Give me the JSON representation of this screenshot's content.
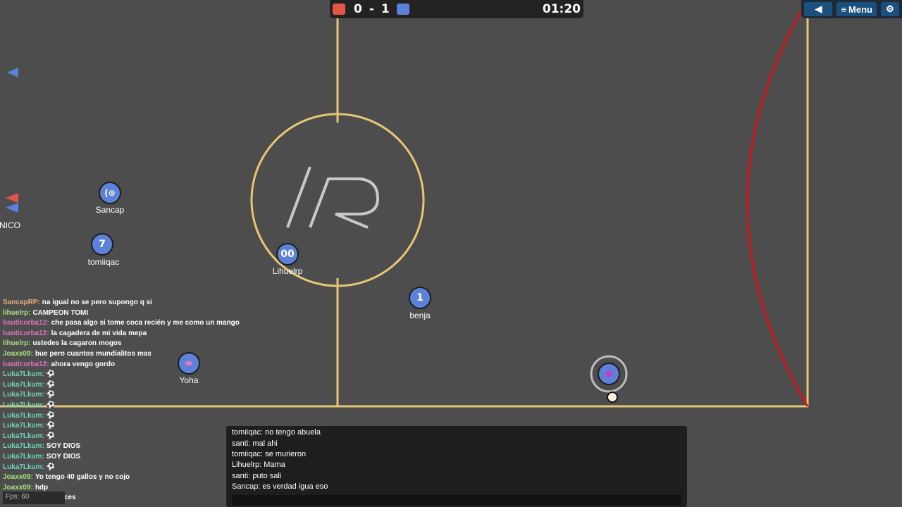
{
  "score": {
    "red": "0",
    "separator": "-",
    "blue": "1",
    "time": "01:20",
    "red_color": "#e0574a",
    "blue_color": "#5b82d8"
  },
  "menu": {
    "sound_icon": "speaker-icon",
    "menu_label": "Menu",
    "settings_icon": "gear-icon"
  },
  "players": [
    {
      "number": "(⊙",
      "name": "Sancap"
    },
    {
      "number": "7",
      "name": "tomiiqac"
    },
    {
      "number": "00",
      "name": "Lihuelrp"
    },
    {
      "number": "1",
      "name": "benja"
    },
    {
      "number": "",
      "name": "Yoha"
    },
    {
      "number": "",
      "name": "NICO"
    }
  ],
  "side_chat": [
    {
      "name": "SancapRP:",
      "text": "na igual no se pero supongo q si",
      "color": "#e0b080"
    },
    {
      "name": "lihuelrp:",
      "text": "CAMPEON TOMI",
      "color": "#a6e07a"
    },
    {
      "name": "bauticorba12:",
      "text": "che pasa algo si tome coca recién y me como un mango",
      "color": "#e070c0"
    },
    {
      "name": "bauticorba12:",
      "text": "la cagadera de mi vida mepa",
      "color": "#e070c0"
    },
    {
      "name": "lihuelrp:",
      "text": "ustedes la cagaron mogos",
      "color": "#a6e07a"
    },
    {
      "name": "Joaxx09:",
      "text": "bue pero cuantos mundialitos mas",
      "color": "#a6e07a"
    },
    {
      "name": "bauticorba12:",
      "text": "ahora vengo gordo",
      "color": "#e070c0"
    },
    {
      "name": "Luka7Lkum:",
      "text": "⚽",
      "color": "#6fd6c0"
    },
    {
      "name": "Luka7Lkum:",
      "text": "⚽",
      "color": "#6fd6c0"
    },
    {
      "name": "Luka7Lkum:",
      "text": "⚽",
      "color": "#6fd6c0"
    },
    {
      "name": "Luka7Lkum:",
      "text": "⚽",
      "color": "#6fd6c0"
    },
    {
      "name": "Luka7Lkum:",
      "text": "⚽",
      "color": "#6fd6c0"
    },
    {
      "name": "Luka7Lkum:",
      "text": "⚽",
      "color": "#6fd6c0"
    },
    {
      "name": "Luka7Lkum:",
      "text": "⚽",
      "color": "#6fd6c0"
    },
    {
      "name": "Luka7Lkum:",
      "text": "SOY DIOS",
      "color": "#6fd6c0"
    },
    {
      "name": "Luka7Lkum:",
      "text": "SOY DIOS",
      "color": "#6fd6c0"
    },
    {
      "name": "Luka7Lkum:",
      "text": "⚽",
      "color": "#6fd6c0"
    },
    {
      "name": "Joaxx09:",
      "text": "Yo tengo 40 gallos y no cojo",
      "color": "#a6e07a"
    },
    {
      "name": "Joaxx09:",
      "text": "hdp",
      "color": "#a6e07a"
    },
    {
      "name": "Joaxx09:",
      "text": "como haces",
      "color": "#a6e07a"
    }
  ],
  "chat": [
    {
      "text": "tomiiqac: no tengo abuela"
    },
    {
      "text": "santi: mal ahi"
    },
    {
      "text": "tomiiqac: se murieron"
    },
    {
      "text": "Lihuelrp: Mama"
    },
    {
      "text": "santi: puto sali"
    },
    {
      "text": "Sancap: es verdad igua eso"
    }
  ],
  "fps_label": "Fps: 60",
  "field": {
    "line_color": "#e8c770",
    "goal_arc_color": "#d4141c",
    "logo_text": "/R"
  }
}
